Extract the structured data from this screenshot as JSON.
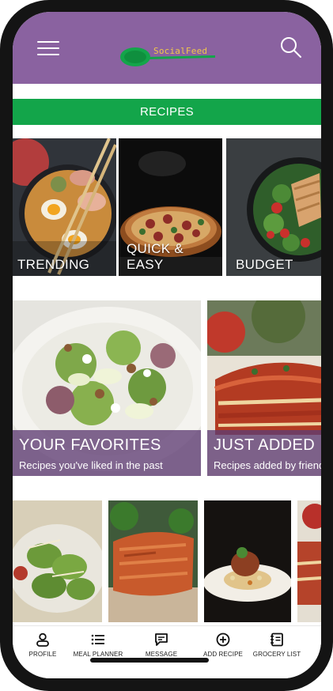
{
  "app": {
    "brand": "SocialFeed"
  },
  "header": {
    "menu_icon": "hamburger-menu-icon",
    "search_icon": "search-icon",
    "bg_color": "#8a62a0"
  },
  "recipes_bar": {
    "label": "RECIPES",
    "color": "#13a54a"
  },
  "categories": [
    {
      "label": "TRENDING",
      "image": "ramen-bowl"
    },
    {
      "label": "QUICK & EASY",
      "image": "pizza"
    },
    {
      "label": "BUDGET",
      "image": "chicken-salad"
    }
  ],
  "collections": [
    {
      "title": "YOUR FAVORITES",
      "subtitle": "Recipes you've liked in the past"
    },
    {
      "title": "JUST ADDED",
      "subtitle": "Recipes added by friends"
    }
  ],
  "recent": [
    {
      "image": "pesto-gnocchi"
    },
    {
      "image": "glazed-chicken"
    },
    {
      "image": "plated-dish"
    },
    {
      "image": "lasagna"
    }
  ],
  "bottom_nav": [
    {
      "label": "PROFILE",
      "icon": "profile-icon"
    },
    {
      "label": "MEAL PLANNER",
      "icon": "list-icon"
    },
    {
      "label": "MESSAGE",
      "icon": "message-icon"
    },
    {
      "label": "ADD RECIPE",
      "icon": "add-circle-icon"
    },
    {
      "label": "GROCERY LIST",
      "icon": "notebook-icon"
    }
  ]
}
